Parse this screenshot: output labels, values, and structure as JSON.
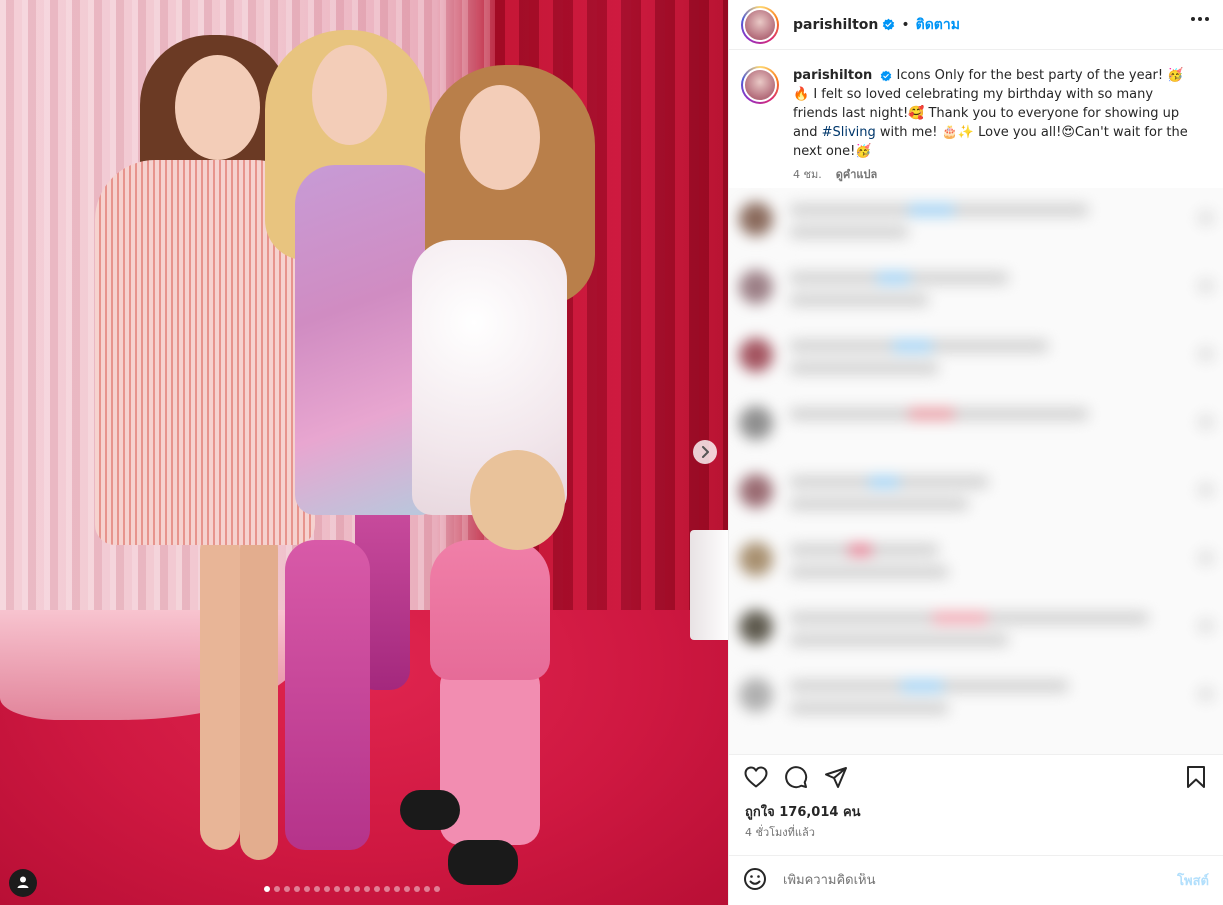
{
  "post": {
    "username": "parishilton",
    "separator": "•",
    "follow_label": "ติดตาม",
    "caption_line1": "Icons Only for the best party of the year! 🥳🔥 I felt so loved celebrating my birthday with so many friends last night!🥰 Thank you to everyone for showing up and ",
    "hashtag": "#Sliving",
    "caption_line2": " with me! 🎂✨ Love you all!😍Can't wait for the next one!🥳",
    "caption_age": "4 ชม.",
    "translate_label": "ดูคำแปล",
    "likes_text": "ถูกใจ 176,014 คน",
    "posted_time": "4 ชั่วโมงที่แล้ว",
    "comment_placeholder": "เพิ่มความคิดเห็น",
    "post_label": "โพสต์"
  },
  "media": {
    "carousel_total": 18,
    "carousel_index": 1
  },
  "colors": {
    "accent": "#0095f6",
    "hashtag": "#00376b",
    "post_disabled": "#b2dffc"
  },
  "icons": {
    "verified": "verified-badge-icon",
    "more": "more-options-icon",
    "like": "heart-icon",
    "comment": "comment-icon",
    "share": "share-icon",
    "save": "bookmark-icon",
    "emoji": "emoji-icon",
    "next": "chevron-right-icon",
    "tagged": "tagged-user-icon"
  }
}
